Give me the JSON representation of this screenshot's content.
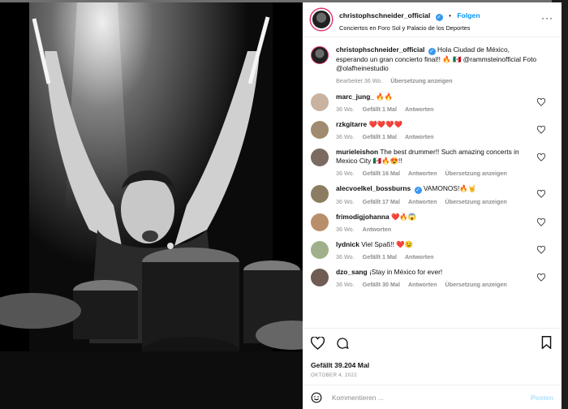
{
  "post": {
    "username": "christophschneider_official",
    "follow_label": "Folgen",
    "location": "Conciertos en Foro Sol y Palacio de los Deportes",
    "caption_user": "christophschneider_official",
    "caption_text": "Hola Ciudad de México, esperando un gran concierto final!! 🔥 🇲🇽 @rammsteinofficial Foto @olafheinestudio",
    "caption_meta": {
      "edited": "Bearbeitet",
      "time": "36 Wo.",
      "translate": "Übersetzung anzeigen"
    }
  },
  "comments": [
    {
      "user": "marc_jung_",
      "text": "🔥🔥",
      "time": "36 Wo.",
      "likes": "Gefällt 1 Mal",
      "reply": "Antworten",
      "translate": "",
      "avatar": "#c9b2a0"
    },
    {
      "user": "rzkgitarre",
      "text": "❤️❤️❤️❤️",
      "time": "36 Wo.",
      "likes": "Gefällt 1 Mal",
      "reply": "Antworten",
      "translate": "",
      "avatar": "#a08b70"
    },
    {
      "user": "murieleishon",
      "text": "The best drummer!! Such amazing concerts in Mexico City 🇲🇽🔥😍!!",
      "time": "36 Wo.",
      "likes": "Gefällt 16 Mal",
      "reply": "Antworten",
      "translate": "Übersetzung anzeigen",
      "avatar": "#7a6a5f"
    },
    {
      "user": "alecvoelkel_bossburns",
      "text": "VAMONOS!🔥🤘",
      "time": "36 Wo.",
      "likes": "Gefällt 17 Mal",
      "reply": "Antworten",
      "translate": "Übersetzung anzeigen",
      "avatar": "#8c7d62",
      "verified": true
    },
    {
      "user": "frimodigjohanna",
      "text": "❤️🔥😱",
      "time": "36 Wo.",
      "likes": "",
      "reply": "Antworten",
      "translate": "",
      "avatar": "#b88f6a"
    },
    {
      "user": "lydnick",
      "text": "Viel Spaß!! ❤️😉",
      "time": "36 Wo.",
      "likes": "Gefällt 1 Mal",
      "reply": "Antworten",
      "translate": "",
      "avatar": "#9fb08a"
    },
    {
      "user": "dzo_sang",
      "text": "¡Stay in México for ever!",
      "time": "36 Wo.",
      "likes": "Gefällt 30 Mal",
      "reply": "Antworten",
      "translate": "Übersetzung anzeigen",
      "avatar": "#6f5c52"
    }
  ],
  "footer": {
    "likes": "Gefällt 39.204 Mal",
    "date": "OKTOBER 4, 2022",
    "comment_placeholder": "Kommentieren ...",
    "post_label": "Posten"
  },
  "icons": {
    "like": "heart-icon",
    "comment": "comment-icon",
    "bookmark": "bookmark-icon",
    "emoji": "emoji-icon",
    "more": "more-icon"
  }
}
